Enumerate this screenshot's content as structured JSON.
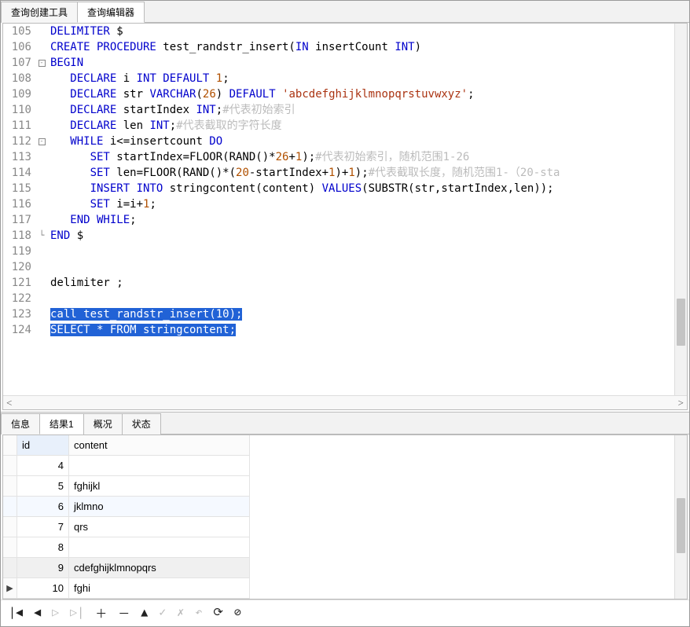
{
  "topTabs": {
    "builder": "查询创建工具",
    "editor": "查询编辑器"
  },
  "code": {
    "lines": [
      {
        "n": 105,
        "seg": [
          {
            "t": "DELIMITER ",
            "c": "kw"
          },
          {
            "t": "$",
            "c": ""
          }
        ]
      },
      {
        "n": 106,
        "seg": [
          {
            "t": "CREATE PROCEDURE",
            "c": "kw"
          },
          {
            "t": " test_randstr_insert(",
            "c": "fn"
          },
          {
            "t": "IN",
            "c": "kw"
          },
          {
            "t": " insertCount ",
            "c": ""
          },
          {
            "t": "INT",
            "c": "kw"
          },
          {
            "t": ")",
            "c": ""
          }
        ]
      },
      {
        "n": 107,
        "fold": "-",
        "seg": [
          {
            "t": "BEGIN",
            "c": "kw"
          }
        ]
      },
      {
        "n": 108,
        "seg": [
          {
            "t": "   DECLARE",
            "c": "kw"
          },
          {
            "t": " i ",
            "c": ""
          },
          {
            "t": "INT DEFAULT",
            "c": "kw"
          },
          {
            "t": " ",
            "c": ""
          },
          {
            "t": "1",
            "c": "num"
          },
          {
            "t": ";",
            "c": ""
          }
        ]
      },
      {
        "n": 109,
        "seg": [
          {
            "t": "   DECLARE",
            "c": "kw"
          },
          {
            "t": " str ",
            "c": ""
          },
          {
            "t": "VARCHAR",
            "c": "kw"
          },
          {
            "t": "(",
            "c": ""
          },
          {
            "t": "26",
            "c": "num"
          },
          {
            "t": ") ",
            "c": ""
          },
          {
            "t": "DEFAULT",
            "c": "kw"
          },
          {
            "t": " ",
            "c": ""
          },
          {
            "t": "'abcdefghijklmnopqrstuvwxyz'",
            "c": "str"
          },
          {
            "t": ";",
            "c": ""
          }
        ]
      },
      {
        "n": 110,
        "seg": [
          {
            "t": "   DECLARE",
            "c": "kw"
          },
          {
            "t": " startIndex ",
            "c": ""
          },
          {
            "t": "INT",
            "c": "kw"
          },
          {
            "t": ";",
            "c": ""
          },
          {
            "t": "#代表初始索引",
            "c": "cmt"
          }
        ]
      },
      {
        "n": 111,
        "seg": [
          {
            "t": "   DECLARE",
            "c": "kw"
          },
          {
            "t": " len ",
            "c": ""
          },
          {
            "t": "INT",
            "c": "kw"
          },
          {
            "t": ";",
            "c": ""
          },
          {
            "t": "#代表截取的字符长度",
            "c": "cmt"
          }
        ]
      },
      {
        "n": 112,
        "fold": "-",
        "seg": [
          {
            "t": "   WHILE",
            "c": "kw"
          },
          {
            "t": " i<=insertcount ",
            "c": ""
          },
          {
            "t": "DO",
            "c": "kw"
          }
        ]
      },
      {
        "n": 113,
        "seg": [
          {
            "t": "      SET",
            "c": "kw"
          },
          {
            "t": " startIndex=FLOOR(RAND()*",
            "c": ""
          },
          {
            "t": "26",
            "c": "num"
          },
          {
            "t": "+",
            "c": ""
          },
          {
            "t": "1",
            "c": "num"
          },
          {
            "t": ");",
            "c": ""
          },
          {
            "t": "#代表初始索引，随机范围1-26",
            "c": "cmt"
          }
        ]
      },
      {
        "n": 114,
        "seg": [
          {
            "t": "      SET",
            "c": "kw"
          },
          {
            "t": " len=FLOOR(RAND()*(",
            "c": ""
          },
          {
            "t": "20",
            "c": "num"
          },
          {
            "t": "-startIndex+",
            "c": ""
          },
          {
            "t": "1",
            "c": "num"
          },
          {
            "t": ")+",
            "c": ""
          },
          {
            "t": "1",
            "c": "num"
          },
          {
            "t": ");",
            "c": ""
          },
          {
            "t": "#代表截取长度，随机范围1-（20-sta",
            "c": "cmt"
          }
        ]
      },
      {
        "n": 115,
        "seg": [
          {
            "t": "      INSERT INTO",
            "c": "kw"
          },
          {
            "t": " stringcontent(content) ",
            "c": ""
          },
          {
            "t": "VALUES",
            "c": "kw"
          },
          {
            "t": "(SUBSTR(str,startIndex,len));",
            "c": ""
          }
        ]
      },
      {
        "n": 116,
        "seg": [
          {
            "t": "      SET",
            "c": "kw"
          },
          {
            "t": " i=i+",
            "c": ""
          },
          {
            "t": "1",
            "c": "num"
          },
          {
            "t": ";",
            "c": ""
          }
        ]
      },
      {
        "n": 117,
        "seg": [
          {
            "t": "   END WHILE",
            "c": "kw"
          },
          {
            "t": ";",
            "c": ""
          }
        ]
      },
      {
        "n": 118,
        "fold": "L",
        "seg": [
          {
            "t": "END",
            "c": "kw"
          },
          {
            "t": " $",
            "c": ""
          }
        ]
      },
      {
        "n": 119,
        "seg": [
          {
            "t": "",
            "c": ""
          }
        ]
      },
      {
        "n": 120,
        "seg": [
          {
            "t": "",
            "c": ""
          }
        ]
      },
      {
        "n": 121,
        "seg": [
          {
            "t": "delimiter ;",
            "c": ""
          }
        ]
      },
      {
        "n": 122,
        "seg": [
          {
            "t": "",
            "c": ""
          }
        ]
      },
      {
        "n": 123,
        "sel": true,
        "seg": [
          {
            "t": "call test_randstr_insert(",
            "c": ""
          },
          {
            "t": "10",
            "c": "num"
          },
          {
            "t": ");",
            "c": ""
          }
        ]
      },
      {
        "n": 124,
        "sel": true,
        "seg": [
          {
            "t": "SELECT * FROM stringcontent;",
            "c": "kw"
          }
        ]
      }
    ]
  },
  "resultTabs": {
    "info": "信息",
    "result1": "结果1",
    "profile": "概况",
    "status": "状态"
  },
  "grid": {
    "cols": [
      "id",
      "content"
    ],
    "rows": [
      {
        "id": "4",
        "content": "",
        "marker": ""
      },
      {
        "id": "5",
        "content": "fghijkl",
        "marker": ""
      },
      {
        "id": "6",
        "content": "jklmno",
        "marker": "",
        "zebra": true
      },
      {
        "id": "7",
        "content": "qrs",
        "marker": ""
      },
      {
        "id": "8",
        "content": "",
        "marker": ""
      },
      {
        "id": "9",
        "content": "cdefghijklmnopqrs",
        "marker": "",
        "selected": true
      },
      {
        "id": "10",
        "content": "fghi",
        "marker": "▶"
      }
    ]
  },
  "toolbar": {
    "first": "|◀",
    "prev": "◀",
    "nextEdit": "▷",
    "lastEdit": "▷|",
    "add": "＋",
    "remove": "－",
    "up": "▲",
    "apply": "✓",
    "cancel": "✗",
    "undo": "↶",
    "refresh": "⟳",
    "stop": "⊘"
  }
}
